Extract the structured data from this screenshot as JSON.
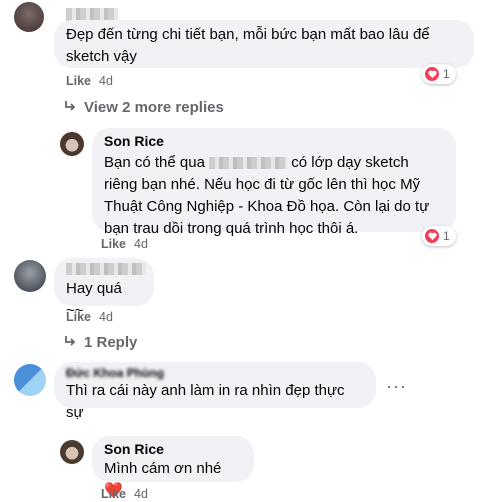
{
  "comments": [
    {
      "id": "c1",
      "text": "Đẹp đến từng chi tiết bạn, mỗi bức bạn mất bao lâu để sketch vậy",
      "like_label": "Like",
      "time": "4d",
      "reaction_count": "1"
    },
    {
      "id": "c1_view_more",
      "label": "View 2 more replies"
    },
    {
      "id": "r1",
      "author": "Son Rice",
      "text_part1": "Bạn có thể qua",
      "text_part2": "có lớp dạy sketch riêng bạn nhé. Nếu học đi từ gốc lên thì học Mỹ Thuật Công Nghiệp - Khoa Đồ họa. Còn lại do tự bạn trau dồi trong quá trình học thôi á.",
      "like_label": "Like",
      "time": "4d",
      "reaction_count": "1"
    },
    {
      "id": "c2",
      "text": "Hay quá ~~",
      "like_label": "Like",
      "time": "4d"
    },
    {
      "id": "c2_reply",
      "label": "1 Reply"
    },
    {
      "id": "c3",
      "author": "Đức Khoa Phùng",
      "text": "Thì ra cái này anh làm in ra nhìn đẹp thực sự",
      "more_label": "···"
    },
    {
      "id": "r2",
      "author": "Son Rice",
      "text": "Mình cám ơn nhé ❤️",
      "like_label": "Like",
      "time": "4d"
    }
  ],
  "colors": {
    "bubble": "#f0f2f5",
    "meta": "#65676b",
    "heart": "#f33e58"
  }
}
